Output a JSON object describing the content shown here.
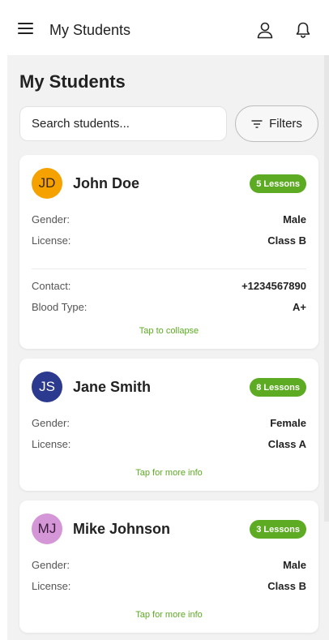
{
  "header": {
    "title": "My Students",
    "menu_icon": "menu-icon",
    "user_icon": "user-icon",
    "bell_icon": "bell-icon"
  },
  "page": {
    "title": "My Students"
  },
  "search": {
    "placeholder": "Search students..."
  },
  "filters": {
    "label": "Filters",
    "icon": "filter-icon"
  },
  "colors": {
    "accent_green": "#5cab22",
    "background": "#f2f2f2"
  },
  "students": [
    {
      "initials": "JD",
      "name": "John Doe",
      "lessons": "5 Lessons",
      "avatar_color": "#f5a100",
      "gender_label": "Gender:",
      "gender": "Male",
      "license_label": "License:",
      "license": "Class B",
      "contact_label": "Contact:",
      "contact": "+1234567890",
      "blood_label": "Blood Type:",
      "blood": "A+",
      "hint": "Tap to collapse"
    },
    {
      "initials": "JS",
      "name": "Jane Smith",
      "lessons": "8 Lessons",
      "avatar_color": "#2b3a8f",
      "gender_label": "Gender:",
      "gender": "Female",
      "license_label": "License:",
      "license": "Class A",
      "hint": "Tap for more info"
    },
    {
      "initials": "MJ",
      "name": "Mike Johnson",
      "lessons": "3 Lessons",
      "avatar_color": "#d596d8",
      "gender_label": "Gender:",
      "gender": "Male",
      "license_label": "License:",
      "license": "Class B",
      "hint": "Tap for more info"
    }
  ]
}
